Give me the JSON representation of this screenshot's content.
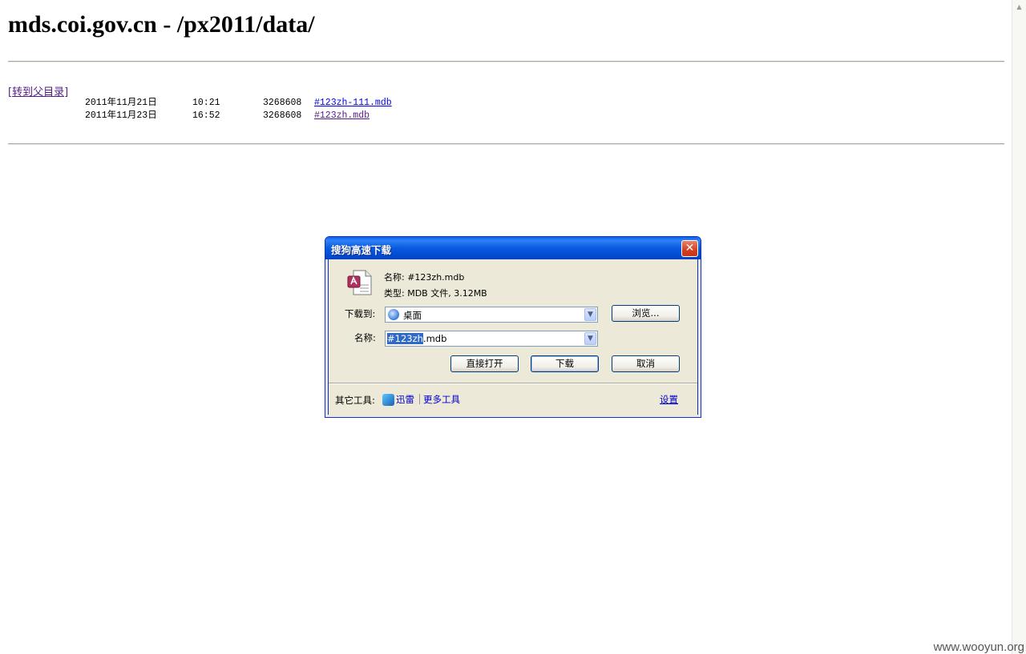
{
  "page": {
    "title": "mds.coi.gov.cn - /px2011/data/",
    "parent_link": "[转到父目录]",
    "files": [
      {
        "date": "2011年11月21日",
        "time": "10:21",
        "size": "3268608",
        "name": "#123zh-111.mdb"
      },
      {
        "date": "2011年11月23日",
        "time": "16:52",
        "size": "3268608",
        "name": "#123zh.mdb"
      }
    ]
  },
  "dialog": {
    "title": "搜狗高速下载",
    "close_glyph": "✕",
    "file_name_line": "名称: #123zh.mdb",
    "file_type_line": "类型: MDB 文件, 3.12MB",
    "dest_label": "下载到:",
    "dest_value": "桌面",
    "browse_label": "浏览...",
    "name_label": "名称:",
    "name_value_selected": "#123zh",
    "name_value_ext": ".mdb",
    "open_label": "直接打开",
    "download_label": "下载",
    "cancel_label": "取消",
    "other_tools_label": "其它工具:",
    "thunder_label": "迅雷",
    "more_tools_label": "更多工具",
    "settings_label": "设置",
    "icons": {
      "file": "mdb-file-icon",
      "dest": "desktop-icon",
      "thunder": "thunder-icon"
    }
  },
  "watermark": "www.wooyun.org"
}
